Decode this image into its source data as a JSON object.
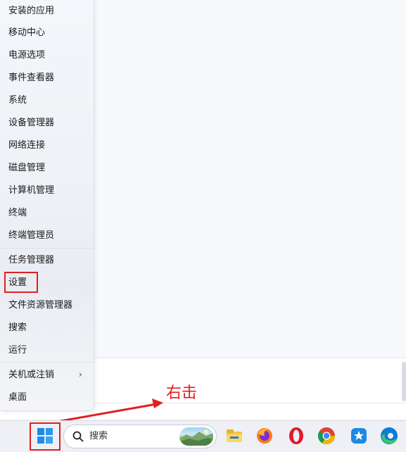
{
  "context_menu": {
    "items": [
      {
        "label": "安装的应用"
      },
      {
        "label": "移动中心"
      },
      {
        "label": "电源选项"
      },
      {
        "label": "事件查看器"
      },
      {
        "label": "系统"
      },
      {
        "label": "设备管理器"
      },
      {
        "label": "网络连接"
      },
      {
        "label": "磁盘管理"
      },
      {
        "label": "计算机管理"
      },
      {
        "label": "终端"
      },
      {
        "label": "终端管理员"
      },
      {
        "label": "任务管理器"
      },
      {
        "label": "设置"
      },
      {
        "label": "文件资源管理器"
      },
      {
        "label": "搜索"
      },
      {
        "label": "运行"
      },
      {
        "label": "关机或注销",
        "submenu_indicator": "›"
      },
      {
        "label": "桌面"
      }
    ]
  },
  "annotation": {
    "text": "右击",
    "color": "#e02020"
  },
  "taskbar": {
    "search_label": "搜索",
    "pinned_icons": [
      "file-explorer-icon",
      "firefox-icon",
      "opera-icon",
      "chrome-icon",
      "pinned-app-icon",
      "edge-icon"
    ]
  }
}
